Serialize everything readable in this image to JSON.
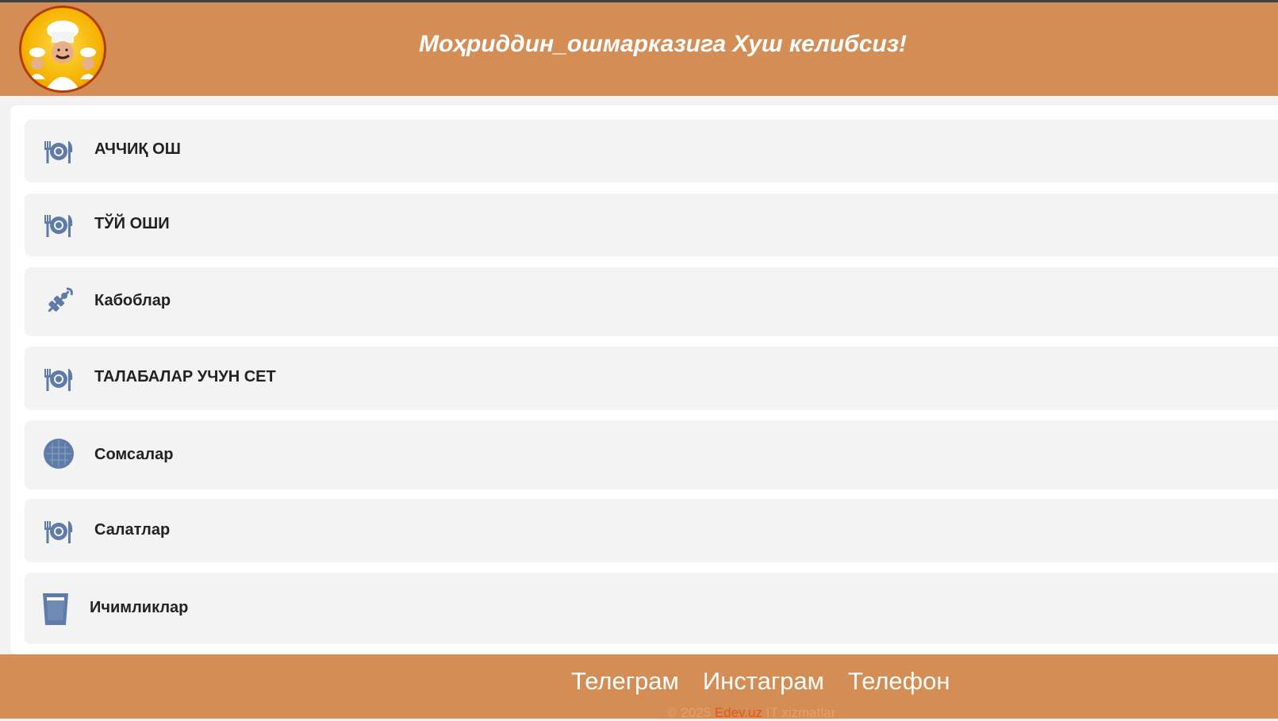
{
  "header": {
    "title": "Моҳриддин_ошмарказига Хуш келибсиз!",
    "logo_icon": "chef-logo-icon"
  },
  "menu": {
    "items": [
      {
        "label": "АЧЧИҚ ОШ",
        "icon": "plate-utensils-icon"
      },
      {
        "label": "ТЎЙ ОШИ",
        "icon": "plate-utensils-icon"
      },
      {
        "label": "Кабоблар",
        "icon": "skewer-icon"
      },
      {
        "label": "ТАЛАБАЛАР УЧУН СЕТ",
        "icon": "plate-utensils-icon"
      },
      {
        "label": "Сомсалар",
        "icon": "pastry-icon"
      },
      {
        "label": "Салатлар",
        "icon": "plate-utensils-icon"
      },
      {
        "label": "Ичимликлар",
        "icon": "drink-glass-icon"
      }
    ]
  },
  "footer": {
    "links": [
      "Телеграм",
      "Инстаграм",
      "Телефон"
    ],
    "copyright_prefix": "© 2025",
    "copyright_brand": "Edev.uz",
    "copyright_suffix": "IT xizmatlar"
  },
  "colors": {
    "header_bg": "#d38d55",
    "icon": "#5f7ba8",
    "brand": "#e0581a"
  }
}
